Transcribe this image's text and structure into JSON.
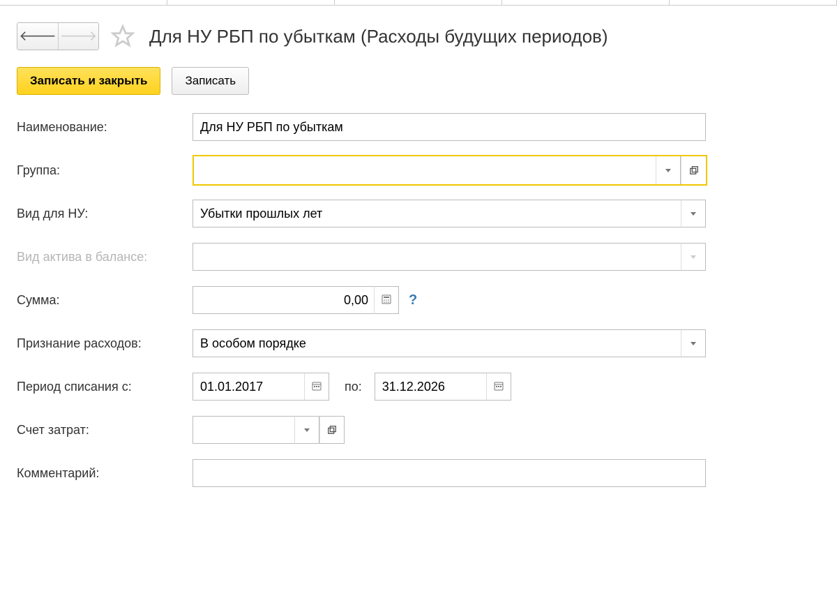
{
  "header": {
    "title": "Для НУ РБП по убыткам (Расходы будущих периодов)"
  },
  "toolbar": {
    "save_close": "Записать и закрыть",
    "save": "Записать"
  },
  "labels": {
    "name": "Наименование:",
    "group": "Группа:",
    "type_nu": "Вид для НУ:",
    "asset_type": "Вид актива в балансе:",
    "amount": "Сумма:",
    "recognition": "Признание расходов:",
    "period_from": "Период списания с:",
    "period_to": "по:",
    "cost_account": "Счет затрат:",
    "comment": "Комментарий:"
  },
  "fields": {
    "name": "Для НУ РБП по убыткам",
    "group": "",
    "type_nu": "Убытки прошлых лет",
    "asset_type": "",
    "amount": "0,00",
    "help": "?",
    "recognition": "В особом порядке",
    "period_from": "01.01.2017",
    "period_to": "31.12.2026",
    "cost_account": "",
    "comment": ""
  }
}
